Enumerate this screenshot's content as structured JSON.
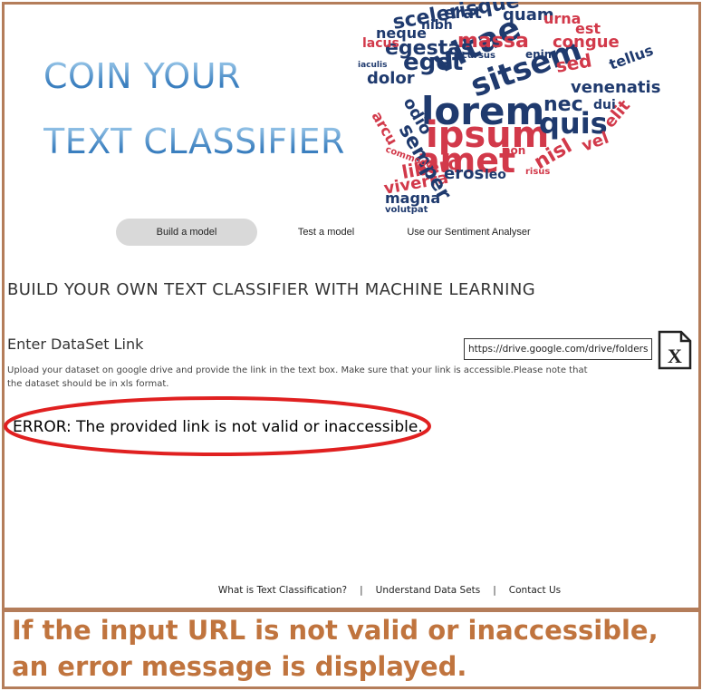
{
  "logo": {
    "line1": "COIN YOUR",
    "line2": "TEXT CLASSIFIER"
  },
  "word_cloud": {
    "words": [
      {
        "t": "lorem",
        "c": "#1f3a6e"
      },
      {
        "t": "ipsum",
        "c": "#d2394a"
      },
      {
        "t": "amet",
        "c": "#d2394a"
      },
      {
        "t": "sitsem",
        "c": "#1f3a6e"
      },
      {
        "t": "vitae",
        "c": "#1f3a6e"
      },
      {
        "t": "eget",
        "c": "#1f3a6e"
      },
      {
        "t": "massa",
        "c": "#d2394a"
      },
      {
        "t": "scelerisque",
        "c": "#1f3a6e"
      },
      {
        "t": "egestas",
        "c": "#1f3a6e"
      },
      {
        "t": "neque",
        "c": "#1f3a6e"
      },
      {
        "t": "quis",
        "c": "#1f3a6e"
      },
      {
        "t": "nec",
        "c": "#1f3a6e"
      },
      {
        "t": "sed",
        "c": "#d2394a"
      },
      {
        "t": "venenatis",
        "c": "#1f3a6e"
      },
      {
        "t": "congue",
        "c": "#d2394a"
      },
      {
        "t": "libero",
        "c": "#d2394a"
      },
      {
        "t": "viverra",
        "c": "#d2394a"
      },
      {
        "t": "magna",
        "c": "#1f3a6e"
      },
      {
        "t": "semper",
        "c": "#1f3a6e"
      },
      {
        "t": "odio",
        "c": "#1f3a6e"
      },
      {
        "t": "dolor",
        "c": "#1f3a6e"
      },
      {
        "t": "nisl",
        "c": "#d2394a"
      },
      {
        "t": "vel",
        "c": "#d2394a"
      },
      {
        "t": "elit",
        "c": "#d2394a"
      },
      {
        "t": "tellus",
        "c": "#1f3a6e"
      },
      {
        "t": "quam",
        "c": "#1f3a6e"
      },
      {
        "t": "erat",
        "c": "#1f3a6e"
      },
      {
        "t": "urna",
        "c": "#d2394a"
      },
      {
        "t": "est",
        "c": "#d2394a"
      },
      {
        "t": "lacus",
        "c": "#d2394a"
      },
      {
        "t": "eros",
        "c": "#1f3a6e"
      },
      {
        "t": "leo",
        "c": "#1f3a6e"
      },
      {
        "t": "arcu",
        "c": "#d2394a"
      },
      {
        "t": "dui",
        "c": "#1f3a6e"
      },
      {
        "t": "non",
        "c": "#d2394a"
      },
      {
        "t": "enim",
        "c": "#1f3a6e"
      },
      {
        "t": "nibh",
        "c": "#1f3a6e"
      },
      {
        "t": "cursus",
        "c": "#1f3a6e"
      },
      {
        "t": "iaculis",
        "c": "#1f3a6e"
      },
      {
        "t": "volutpat",
        "c": "#1f3a6e"
      },
      {
        "t": "risus",
        "c": "#d2394a"
      },
      {
        "t": "commodo",
        "c": "#d2394a"
      }
    ]
  },
  "nav": [
    {
      "label": "Build a  model"
    },
    {
      "label": "Test a model"
    },
    {
      "label": "Use our Sentiment Analyser"
    }
  ],
  "page": {
    "heading": "BUILD YOUR OWN TEXT CLASSIFIER WITH MACHINE LEARNING",
    "dataset_label": "Enter DataSet Link",
    "help_text": "Upload your dataset on google drive and provide the link in the text box.  Make sure that your link is accessible.Please note that the dataset should be in xls format.",
    "url_value": "https://drive.google.com/drive/folders/d",
    "error": "ERROR: The provided link is not valid or inaccessible."
  },
  "footer": {
    "link1": "What is Text Classification?",
    "link2": "Understand Data Sets",
    "link3": "Contact Us",
    "sep": "|"
  },
  "caption": "If the input URL is not valid or inaccessible, an error message is displayed.",
  "colors": {
    "border": "#b47d5a",
    "caption": "#c0743e",
    "error_ellipse": "#e02020",
    "cloud_blue": "#1f3a6e",
    "cloud_red": "#d2394a"
  }
}
